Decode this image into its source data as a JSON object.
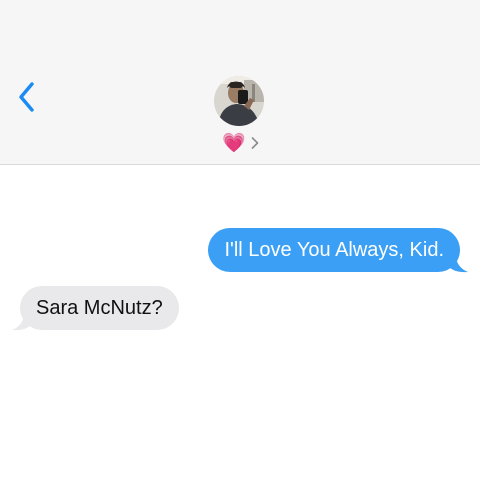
{
  "header": {
    "back_icon": "chevron-left-icon",
    "contact_emoji": "💗",
    "disclosure_icon": "chevron-right-icon"
  },
  "messages": [
    {
      "direction": "outgoing",
      "text": "I'll Love You Always, Kid."
    },
    {
      "direction": "incoming",
      "text": "Sara McNutz?"
    }
  ],
  "colors": {
    "accent": "#1a8af5",
    "outgoing_bubble": "#3ba0f5",
    "incoming_bubble": "#e9e9eb",
    "header_bg": "#f6f6f6"
  }
}
